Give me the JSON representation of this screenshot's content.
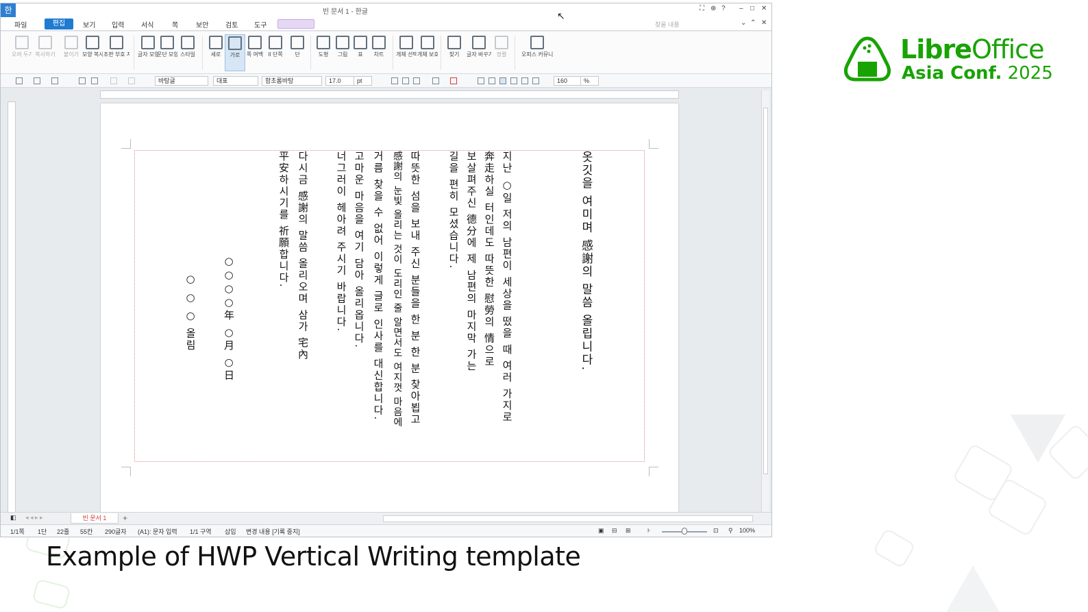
{
  "caption": "Example of HWP Vertical Writing template",
  "logo": {
    "name_bold": "Libre",
    "name_regular": "Office",
    "sub_bold": "Asia Conf.",
    "sub_regular": "2025"
  },
  "app": {
    "icon_glyph": "한",
    "title": "빈 문서 1 - 한글",
    "menus": [
      "파일",
      "편집",
      "보기",
      "입력",
      "서식",
      "쪽",
      "보안",
      "검토",
      "도구"
    ],
    "search_placeholder": "찾을 내용",
    "ribbon": [
      {
        "label": "오려 두기",
        "disabled": true
      },
      {
        "label": "복사하기",
        "disabled": true
      },
      {
        "label": "붙이기",
        "disabled": true
      },
      {
        "label": "모양 복사",
        "disabled": false
      },
      {
        "label": "조판 부호 지우기",
        "disabled": false
      },
      {
        "label": "글자 모양",
        "disabled": false
      },
      {
        "label": "문단 모양",
        "disabled": false
      },
      {
        "label": "스타일",
        "disabled": false
      },
      {
        "label": "세로",
        "disabled": false
      },
      {
        "label": "가로",
        "disabled": false,
        "active": true
      },
      {
        "label": "쪽 여백",
        "disabled": false
      },
      {
        "label": "II 단쪽",
        "disabled": false
      },
      {
        "label": "단",
        "disabled": false
      },
      {
        "label": "도형",
        "disabled": false
      },
      {
        "label": "그림",
        "disabled": false
      },
      {
        "label": "표",
        "disabled": false
      },
      {
        "label": "차트",
        "disabled": false
      },
      {
        "label": "개체 선택",
        "disabled": false
      },
      {
        "label": "개체 보호",
        "disabled": false
      },
      {
        "label": "찾기",
        "disabled": false
      },
      {
        "label": "글자 바꾸기",
        "disabled": false
      },
      {
        "label": "정렬",
        "disabled": true
      },
      {
        "label": "오피스 커뮤니케이터",
        "disabled": false
      }
    ],
    "format": {
      "style": "바탕글",
      "lang": "대표",
      "font": "함초롬바탕",
      "size": "17.0",
      "unit": "pt",
      "zoom_value": "160",
      "zoom_unit": "%"
    },
    "sheet_tab": "빈 문서 1",
    "status": {
      "page": "1/1쪽",
      "section": "1단",
      "line": "22줄",
      "column": "55칸",
      "chars": "290글자",
      "input_mode": "(A1): 문자 입력",
      "section_count": "1/1 구역",
      "insert": "삽입",
      "track": "변경 내용 [기록 중지]",
      "zoom": "100%"
    }
  },
  "document": {
    "columns": [
      "옷깃을 여미며 感謝의 말씀 올립니다.",
      "지난 ○일 저의 남편이 세상을 떴을 때 여러 가지로",
      "奔走하실 터인데도 따뜻한 慰勞의 情으로",
      "보살펴주신 德分에 제 남편의 마지막 가는",
      "길을 편히 모셨습니다.",
      "따뜻한 섬을 보내 주신 분들을 한 분 한 분 찾아뵙고",
      "感謝의 눈빛 올리는 것이 도리인 줄 알면서도 여지껏 마음에",
      "거름 찾을 수 없어 이렇게 글로 인사를 대신합니다.",
      "고마운 마음을 여기 담아 올리옵니다.",
      "너그러이 헤아려 주시기 바랍니다.",
      "다시금 感謝의 말씀 올리오며 삼가 宅內",
      "平安하시기를 祈願합니다.",
      "○○○○年 ○月 ○日",
      "○ ○ ○ 올림"
    ]
  }
}
